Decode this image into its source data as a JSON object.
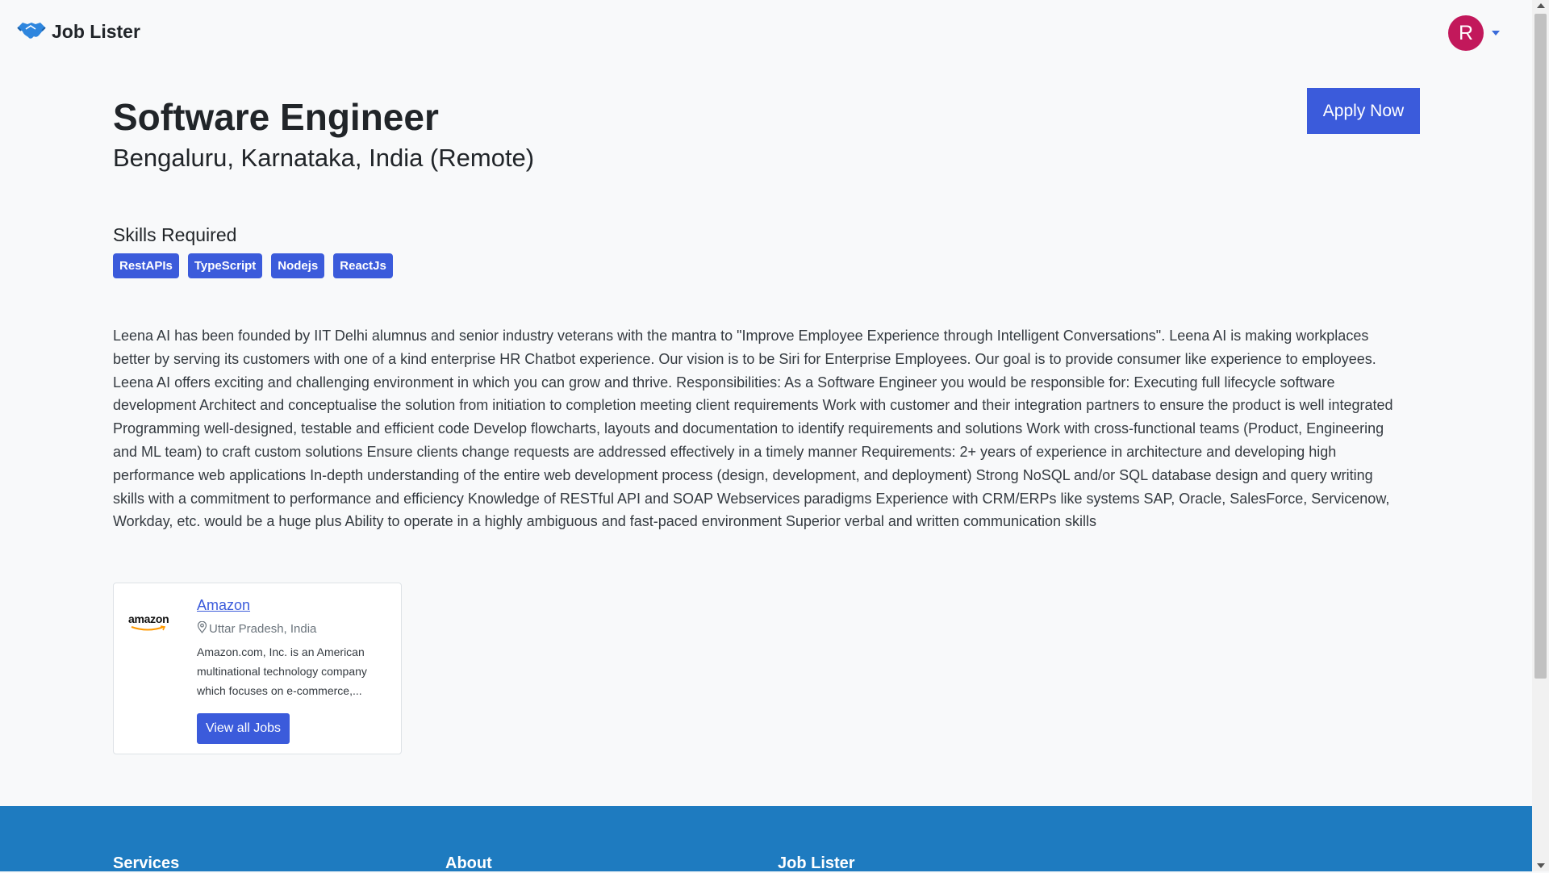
{
  "navbar": {
    "brand_text": "Job Lister",
    "brand_icon": "handshake-icon",
    "avatar_initial": "R",
    "avatar_color": "#c2185b"
  },
  "job": {
    "title": "Software Engineer",
    "location": "Bengaluru, Karnataka, India (Remote)",
    "apply_label": "Apply Now",
    "skills_heading": "Skills Required",
    "skills": [
      "RestAPIs",
      "TypeScript",
      "Nodejs",
      "ReactJs"
    ],
    "description": "Leena AI has been founded by IIT Delhi alumnus and senior industry veterans with the mantra to \"Improve Employee Experience through Intelligent Conversations\". Leena AI is making workplaces better by serving its customers with one of a kind enterprise HR Chatbot experience. Our vision is to be Siri for Enterprise Employees. Our goal is to provide consumer like experience to employees. Leena AI offers exciting and challenging environment in which you can grow and thrive. Responsibilities: As a Software Engineer you would be responsible for: Executing full lifecycle software development Architect and conceptualise the solution from initiation to completion meeting client requirements Work with customer and their integration partners to ensure the product is well integrated Programming well-designed, testable and efficient code Develop flowcharts, layouts and documentation to identify requirements and solutions Work with cross-functional teams (Product, Engineering and ML team) to craft custom solutions Ensure clients change requests are addressed effectively in a timely manner Requirements: 2+ years of experience in architecture and developing high performance web applications In-depth understanding of the entire web development process (design, development, and deployment) Strong NoSQL and/or SQL database design and query writing skills with a commitment to performance and efficiency Knowledge of RESTful API and SOAP Webservices paradigms Experience with CRM/ERPs like systems SAP, Oracle, SalesForce, Servicenow, Workday, etc. would be a huge plus Ability to operate in a highly ambiguous and fast-paced environment Superior verbal and written communication skills"
  },
  "company": {
    "logo_text": "amazon",
    "name": "Amazon",
    "location": "Uttar Pradesh, India",
    "description": "Amazon.com, Inc. is an American multinational technology company which focuses on e-commerce,...",
    "jobs_button": "View all Jobs"
  },
  "footer": {
    "col1": "Services",
    "col2": "About",
    "col3": "Job Lister"
  },
  "colors": {
    "accent": "#3b5bdb",
    "footer_bg": "#1e7bc0",
    "page_bg": "#f8f9fa"
  }
}
